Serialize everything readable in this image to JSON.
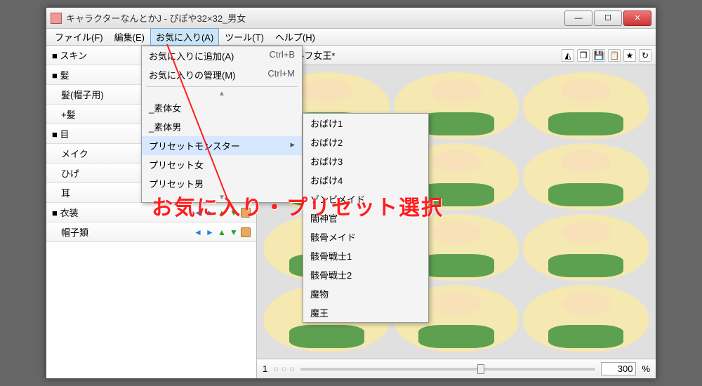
{
  "window": {
    "title": "キャラクターなんとかJ - ぴぽや32×32_男女"
  },
  "menubar": {
    "file": "ファイル(F)",
    "edit": "編集(E)",
    "favorites": "お気に入り(A)",
    "tools": "ツール(T)",
    "help": "ヘルプ(H)"
  },
  "categories": [
    "■ スキン",
    "■ 髪",
    "　髪(帽子用)",
    "　+髪",
    "■ 目",
    "　メイク",
    "　ひげ",
    "　耳",
    "■ 衣装",
    "　帽子類"
  ],
  "righttop": {
    "label": "ト女|エルフ女王*"
  },
  "toolbar_icons": [
    {
      "name": "flip-icon",
      "glyph": "◭"
    },
    {
      "name": "copy-icon",
      "glyph": "❐"
    },
    {
      "name": "save-icon",
      "glyph": "💾"
    },
    {
      "name": "paste-icon",
      "glyph": "📋"
    },
    {
      "name": "star-icon",
      "glyph": "★"
    },
    {
      "name": "refresh-icon",
      "glyph": "↻"
    }
  ],
  "favorites_menu": {
    "add": {
      "label": "お気に入りに追加(A)",
      "shortcut": "Ctrl+B"
    },
    "manage": {
      "label": "お気に入りの管理(M)",
      "shortcut": "Ctrl+M"
    },
    "presets": [
      "_素体女",
      "_素体男",
      "プリセットモンスター",
      "プリセット女",
      "プリセット男"
    ]
  },
  "monster_submenu": [
    "おばけ1",
    "おばけ2",
    "おばけ3",
    "おばけ4",
    "ゾンビメイド",
    "闇神官",
    "骸骨メイド",
    "骸骨戦士1",
    "骸骨戦士2",
    "魔物",
    "魔王"
  ],
  "zoom": {
    "value": "300",
    "unit": "%"
  },
  "annotation": "お気に入り・プリセット選択"
}
